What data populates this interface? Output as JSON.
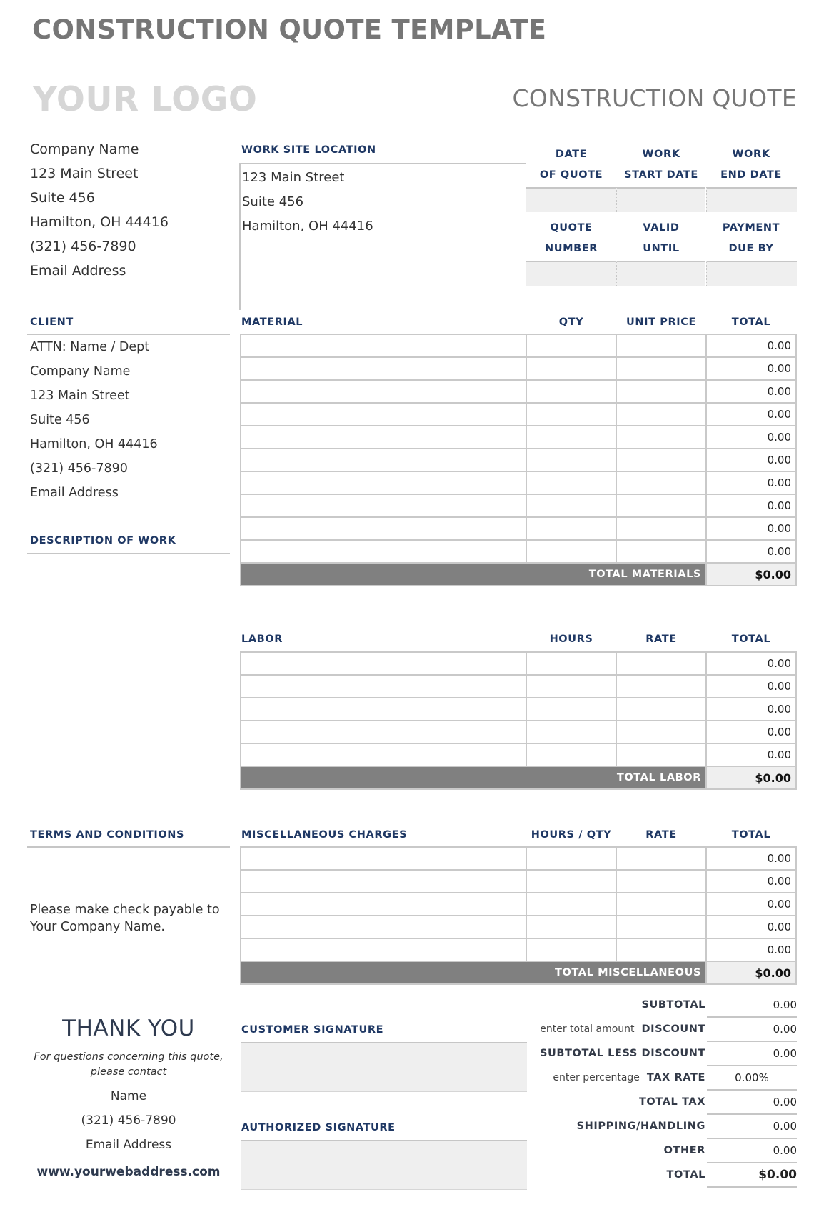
{
  "page_title": "CONSTRUCTION QUOTE TEMPLATE",
  "logo_placeholder": "YOUR LOGO",
  "document_title": "CONSTRUCTION QUOTE",
  "company": {
    "lines": [
      "Company Name",
      "123 Main Street",
      "Suite 456",
      "Hamilton, OH  44416",
      "(321) 456-7890",
      "Email Address"
    ]
  },
  "work_site": {
    "label": "WORK SITE LOCATION",
    "lines": [
      "123 Main Street",
      "Suite 456",
      "Hamilton, OH  44416"
    ]
  },
  "info_grid": {
    "row1": [
      {
        "line1": "DATE",
        "line2": "OF QUOTE",
        "value": ""
      },
      {
        "line1": "WORK",
        "line2": "START DATE",
        "value": ""
      },
      {
        "line1": "WORK",
        "line2": "END DATE",
        "value": ""
      }
    ],
    "row2": [
      {
        "line1": "QUOTE",
        "line2": "NUMBER",
        "value": ""
      },
      {
        "line1": "VALID",
        "line2": "UNTIL",
        "value": ""
      },
      {
        "line1": "PAYMENT",
        "line2": "DUE BY",
        "value": ""
      }
    ]
  },
  "client": {
    "label": "CLIENT",
    "lines": [
      "ATTN: Name / Dept",
      "Company Name",
      "123 Main Street",
      "Suite 456",
      "Hamilton, OH  44416",
      "(321) 456-7890",
      "Email Address"
    ]
  },
  "description_of_work": {
    "label": "DESCRIPTION OF WORK",
    "value": ""
  },
  "materials": {
    "headers": [
      "MATERIAL",
      "QTY",
      "UNIT PRICE",
      "TOTAL"
    ],
    "rows": [
      {
        "item": "",
        "qty": "",
        "unit_price": "",
        "total": "0.00"
      },
      {
        "item": "",
        "qty": "",
        "unit_price": "",
        "total": "0.00"
      },
      {
        "item": "",
        "qty": "",
        "unit_price": "",
        "total": "0.00"
      },
      {
        "item": "",
        "qty": "",
        "unit_price": "",
        "total": "0.00"
      },
      {
        "item": "",
        "qty": "",
        "unit_price": "",
        "total": "0.00"
      },
      {
        "item": "",
        "qty": "",
        "unit_price": "",
        "total": "0.00"
      },
      {
        "item": "",
        "qty": "",
        "unit_price": "",
        "total": "0.00"
      },
      {
        "item": "",
        "qty": "",
        "unit_price": "",
        "total": "0.00"
      },
      {
        "item": "",
        "qty": "",
        "unit_price": "",
        "total": "0.00"
      },
      {
        "item": "",
        "qty": "",
        "unit_price": "",
        "total": "0.00"
      }
    ],
    "total_label": "TOTAL MATERIALS",
    "total_value": "$0.00"
  },
  "labor": {
    "headers": [
      "LABOR",
      "HOURS",
      "RATE",
      "TOTAL"
    ],
    "rows": [
      {
        "item": "",
        "hours": "",
        "rate": "",
        "total": "0.00"
      },
      {
        "item": "",
        "hours": "",
        "rate": "",
        "total": "0.00"
      },
      {
        "item": "",
        "hours": "",
        "rate": "",
        "total": "0.00"
      },
      {
        "item": "",
        "hours": "",
        "rate": "",
        "total": "0.00"
      },
      {
        "item": "",
        "hours": "",
        "rate": "",
        "total": "0.00"
      }
    ],
    "total_label": "TOTAL LABOR",
    "total_value": "$0.00"
  },
  "misc": {
    "headers": [
      "MISCELLANEOUS CHARGES",
      "HOURS / QTY",
      "RATE",
      "TOTAL"
    ],
    "rows": [
      {
        "item": "",
        "qty": "",
        "rate": "",
        "total": "0.00"
      },
      {
        "item": "",
        "qty": "",
        "rate": "",
        "total": "0.00"
      },
      {
        "item": "",
        "qty": "",
        "rate": "",
        "total": "0.00"
      },
      {
        "item": "",
        "qty": "",
        "rate": "",
        "total": "0.00"
      },
      {
        "item": "",
        "qty": "",
        "rate": "",
        "total": "0.00"
      }
    ],
    "total_label": "TOTAL MISCELLANEOUS",
    "total_value": "$0.00"
  },
  "terms": {
    "label": "TERMS AND CONDITIONS",
    "text_line1": "Please make check payable to",
    "text_line2": "Your Company Name."
  },
  "summary": [
    {
      "label": "SUBTOTAL",
      "hint": "",
      "value": "0.00"
    },
    {
      "label": "DISCOUNT",
      "hint": "enter total amount",
      "value": "0.00"
    },
    {
      "label": "SUBTOTAL LESS DISCOUNT",
      "hint": "",
      "value": "0.00"
    },
    {
      "label": "TAX RATE",
      "hint": "enter percentage",
      "value": "0.00%"
    },
    {
      "label": "TOTAL TAX",
      "hint": "",
      "value": "0.00"
    },
    {
      "label": "SHIPPING/HANDLING",
      "hint": "",
      "value": "0.00"
    },
    {
      "label": "OTHER",
      "hint": "",
      "value": "0.00"
    },
    {
      "label": "TOTAL",
      "hint": "",
      "value": "$0.00"
    }
  ],
  "signatures": {
    "customer_label": "CUSTOMER SIGNATURE",
    "authorized_label": "AUTHORIZED SIGNATURE"
  },
  "thank_you": {
    "heading": "THANK YOU",
    "note_line1": "For questions concerning this quote,",
    "note_line2": "please contact",
    "name": "Name",
    "phone": "(321) 456-7890",
    "email": "Email Address",
    "website": "www.yourwebaddress.com"
  },
  "colors": {
    "heading_navy": "#1f3864",
    "total_bar": "#808080",
    "input_gray": "#efefef",
    "title_gray": "#767676",
    "logo_gray": "#d6d6d6"
  }
}
